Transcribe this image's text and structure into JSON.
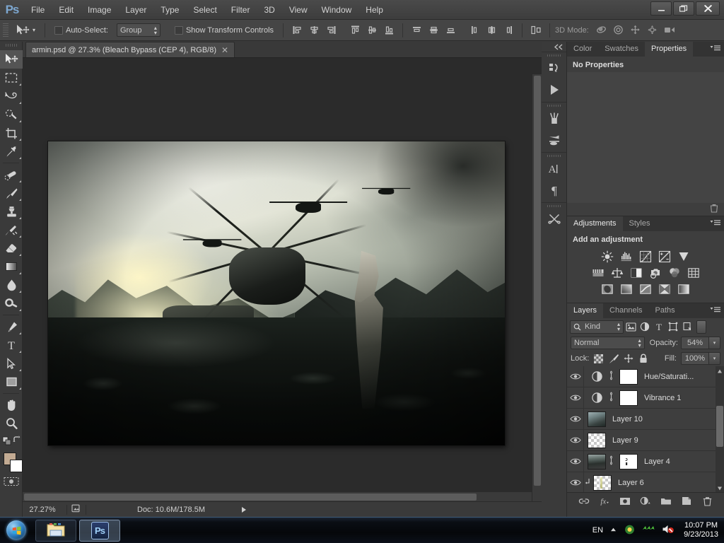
{
  "app": {
    "name": "Adobe Photoshop",
    "logo_text": "Ps"
  },
  "menubar": {
    "items": [
      {
        "label": "File"
      },
      {
        "label": "Edit"
      },
      {
        "label": "Image"
      },
      {
        "label": "Layer"
      },
      {
        "label": "Type"
      },
      {
        "label": "Select"
      },
      {
        "label": "Filter"
      },
      {
        "label": "3D"
      },
      {
        "label": "View"
      },
      {
        "label": "Window"
      },
      {
        "label": "Help"
      }
    ]
  },
  "window_controls": {
    "minimize": "–",
    "restore": "❐",
    "close": "✕"
  },
  "options_bar": {
    "tool": "move-tool",
    "auto_select_label": "Auto-Select:",
    "auto_select_checked": false,
    "auto_select_value": "Group",
    "show_transform_label": "Show Transform Controls",
    "show_transform_checked": false,
    "align_icons": [
      "align-left-edges-icon",
      "align-horizontal-centers-icon",
      "align-right-edges-icon",
      "align-top-edges-icon",
      "align-vertical-centers-icon",
      "align-bottom-edges-icon"
    ],
    "distribute_icons": [
      "distribute-top-edges-icon",
      "distribute-vertical-centers-icon",
      "distribute-bottom-edges-icon",
      "distribute-left-edges-icon",
      "distribute-horizontal-centers-icon",
      "distribute-right-edges-icon"
    ],
    "auto_align_icon": "auto-align-layers-icon",
    "mode_3d_label": "3D Mode:",
    "mode_3d_icons": [
      "orbit-3d-icon",
      "roll-3d-icon",
      "pan-3d-icon",
      "slide-3d-icon",
      "scale-3d-icon"
    ]
  },
  "toolbar": {
    "tools": [
      {
        "name": "move-tool",
        "active": true,
        "has_flyout": false
      },
      {
        "name": "rectangular-marquee-tool",
        "active": false,
        "has_flyout": true
      },
      {
        "name": "lasso-tool",
        "active": false,
        "has_flyout": true
      },
      {
        "name": "quick-selection-tool",
        "active": false,
        "has_flyout": true
      },
      {
        "name": "crop-tool",
        "active": false,
        "has_flyout": true
      },
      {
        "name": "eyedropper-tool",
        "active": false,
        "has_flyout": true
      },
      {
        "name": "spot-healing-brush-tool",
        "active": false,
        "has_flyout": true
      },
      {
        "name": "brush-tool",
        "active": false,
        "has_flyout": true
      },
      {
        "name": "clone-stamp-tool",
        "active": false,
        "has_flyout": true
      },
      {
        "name": "history-brush-tool",
        "active": false,
        "has_flyout": true
      },
      {
        "name": "eraser-tool",
        "active": false,
        "has_flyout": true
      },
      {
        "name": "gradient-tool",
        "active": false,
        "has_flyout": true
      },
      {
        "name": "blur-tool",
        "active": false,
        "has_flyout": true
      },
      {
        "name": "dodge-tool",
        "active": false,
        "has_flyout": true
      },
      {
        "name": "pen-tool",
        "active": false,
        "has_flyout": true
      },
      {
        "name": "horizontal-type-tool",
        "active": false,
        "has_flyout": true
      },
      {
        "name": "path-selection-tool",
        "active": false,
        "has_flyout": true
      },
      {
        "name": "rectangle-tool",
        "active": false,
        "has_flyout": true
      },
      {
        "name": "hand-tool",
        "active": false,
        "has_flyout": false
      },
      {
        "name": "zoom-tool",
        "active": false,
        "has_flyout": false
      }
    ],
    "foreground_color": "#c3ab93",
    "background_color": "#ffffff",
    "quick_mask_name": "edit-in-quick-mask-mode"
  },
  "document": {
    "tab_title": "armin.psd @ 27.3% (Bleach Bypass (CEP 4), RGB/8)",
    "tab_close": "✕"
  },
  "status_bar": {
    "zoom": "27.27%",
    "doc_label": "Doc: 10.6M/178.5M"
  },
  "mini_dock": {
    "collapse_icon": "collapse-panels-icon",
    "groups": [
      {
        "icons": [
          {
            "name": "history-panel-icon"
          },
          {
            "name": "actions-panel-icon"
          }
        ]
      },
      {
        "icons": [
          {
            "name": "brush-panel-icon"
          },
          {
            "name": "brush-presets-panel-icon"
          }
        ]
      },
      {
        "icons": [
          {
            "name": "character-panel-icon"
          },
          {
            "name": "paragraph-panel-icon"
          }
        ]
      },
      {
        "icons": [
          {
            "name": "tool-presets-panel-icon"
          }
        ]
      }
    ]
  },
  "properties_panel": {
    "tabs": [
      {
        "label": "Color",
        "active": false
      },
      {
        "label": "Swatches",
        "active": false
      },
      {
        "label": "Properties",
        "active": true
      }
    ],
    "empty_text": "No Properties",
    "menu_icon": "panel-menu-icon",
    "delete_icon": "trash-icon"
  },
  "adjustments_panel": {
    "tabs": [
      {
        "label": "Adjustments",
        "active": true
      },
      {
        "label": "Styles",
        "active": false
      }
    ],
    "heading": "Add an adjustment",
    "menu_icon": "panel-menu-icon",
    "rows": [
      [
        {
          "name": "brightness-contrast-icon"
        },
        {
          "name": "levels-icon"
        },
        {
          "name": "curves-icon"
        },
        {
          "name": "exposure-icon"
        },
        {
          "name": "vibrance-icon"
        }
      ],
      [
        {
          "name": "hue-saturation-icon"
        },
        {
          "name": "color-balance-icon"
        },
        {
          "name": "black-and-white-icon"
        },
        {
          "name": "photo-filter-icon"
        },
        {
          "name": "channel-mixer-icon"
        },
        {
          "name": "color-lookup-icon"
        }
      ],
      [
        {
          "name": "invert-icon"
        },
        {
          "name": "posterize-icon"
        },
        {
          "name": "threshold-icon"
        },
        {
          "name": "selective-color-icon"
        },
        {
          "name": "gradient-map-icon"
        }
      ]
    ]
  },
  "layers_panel": {
    "tabs": [
      {
        "label": "Layers",
        "active": true
      },
      {
        "label": "Channels",
        "active": false
      },
      {
        "label": "Paths",
        "active": false
      }
    ],
    "menu_icon": "panel-menu-icon",
    "filter": {
      "search_icon": "search-icon",
      "kind_label": "Kind",
      "type_filters": [
        {
          "name": "filter-pixel-layers-icon"
        },
        {
          "name": "filter-adjustment-layers-icon"
        },
        {
          "name": "filter-type-layers-icon"
        },
        {
          "name": "filter-shape-layers-icon"
        },
        {
          "name": "filter-smart-object-layers-icon"
        }
      ],
      "toggle_name": "filter-enable-toggle"
    },
    "blend_mode": "Normal",
    "opacity_label": "Opacity:",
    "opacity_value": "54%",
    "lock_label": "Lock:",
    "lock_icons": [
      {
        "name": "lock-transparent-pixels-icon"
      },
      {
        "name": "lock-image-pixels-icon"
      },
      {
        "name": "lock-position-icon"
      },
      {
        "name": "lock-all-icon"
      }
    ],
    "fill_label": "Fill:",
    "fill_value": "100%",
    "layers": [
      {
        "name": "Hue/Saturati...",
        "visible": true,
        "thumb_type": "adjustment",
        "adjustment_icon": "hue-saturation-icon",
        "linked": true,
        "has_mask": true,
        "clipped": false
      },
      {
        "name": "Vibrance 1",
        "visible": true,
        "thumb_type": "adjustment",
        "adjustment_icon": "vibrance-adjustment-icon",
        "linked": true,
        "has_mask": true,
        "clipped": false
      },
      {
        "name": "Layer 10",
        "visible": true,
        "thumb_type": "photo",
        "linked": false,
        "has_mask": false,
        "clipped": false
      },
      {
        "name": "Layer 9",
        "visible": true,
        "thumb_type": "transparent",
        "linked": false,
        "has_mask": false,
        "clipped": false
      },
      {
        "name": "Layer 4",
        "visible": true,
        "thumb_type": "photo2",
        "linked": true,
        "has_mask": true,
        "clipped": false
      },
      {
        "name": "Layer 6",
        "visible": true,
        "thumb_type": "transparent",
        "linked": false,
        "has_mask": false,
        "clipped": true
      }
    ],
    "footer_icons": [
      {
        "name": "link-layers-icon"
      },
      {
        "name": "layer-style-fx-icon"
      },
      {
        "name": "add-layer-mask-icon"
      },
      {
        "name": "new-adjustment-layer-icon"
      },
      {
        "name": "new-group-icon"
      },
      {
        "name": "new-layer-icon"
      },
      {
        "name": "delete-layer-icon"
      }
    ]
  },
  "taskbar": {
    "start_name": "windows-start-orb",
    "items": [
      {
        "name": "windows-explorer-taskbar-button",
        "active": false
      },
      {
        "name": "photoshop-taskbar-button",
        "active": true,
        "label": "Ps"
      }
    ],
    "tray": {
      "language": "EN",
      "show_hidden_icons": "show-hidden-icons-arrow",
      "icons": [
        {
          "name": "messenger-tray-icon"
        },
        {
          "name": "network-tray-icon"
        },
        {
          "name": "volume-muted-tray-icon"
        }
      ],
      "time": "10:07 PM",
      "date": "9/23/2013"
    }
  },
  "colors": {
    "accent": "#7da7d0",
    "panel_bg": "#3e3e3e",
    "chrome_bg": "#3a3a3a",
    "canvas_bg": "#2b2b2b"
  }
}
